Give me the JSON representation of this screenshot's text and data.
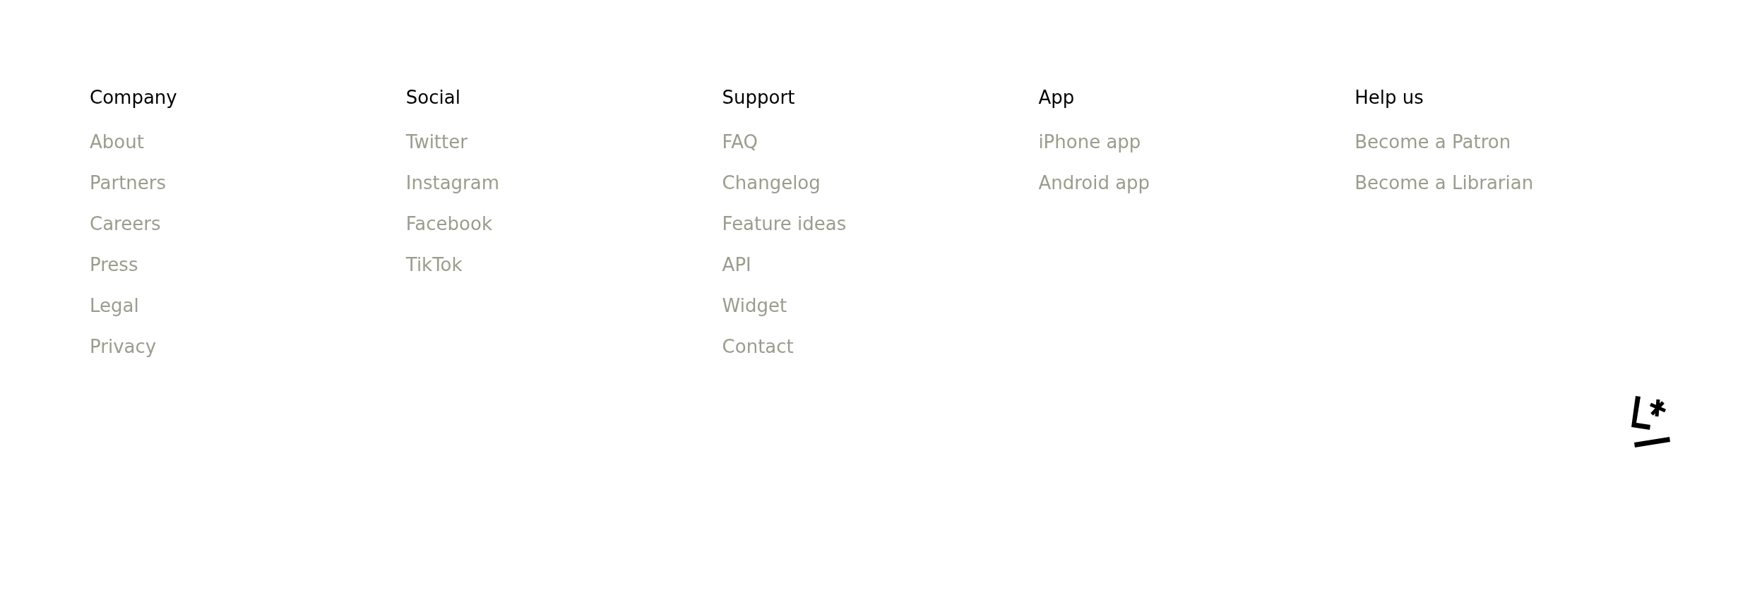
{
  "columns": [
    {
      "heading": "Company",
      "links": [
        "About",
        "Partners",
        "Careers",
        "Press",
        "Legal",
        "Privacy"
      ]
    },
    {
      "heading": "Social",
      "links": [
        "Twitter",
        "Instagram",
        "Facebook",
        "TikTok"
      ]
    },
    {
      "heading": "Support",
      "links": [
        "FAQ",
        "Changelog",
        "Feature ideas",
        "API",
        "Widget",
        "Contact"
      ]
    },
    {
      "heading": "App",
      "links": [
        "iPhone app",
        "Android app"
      ]
    },
    {
      "heading": "Help us",
      "links": [
        "Become a Patron",
        "Become a Librarian"
      ]
    }
  ]
}
